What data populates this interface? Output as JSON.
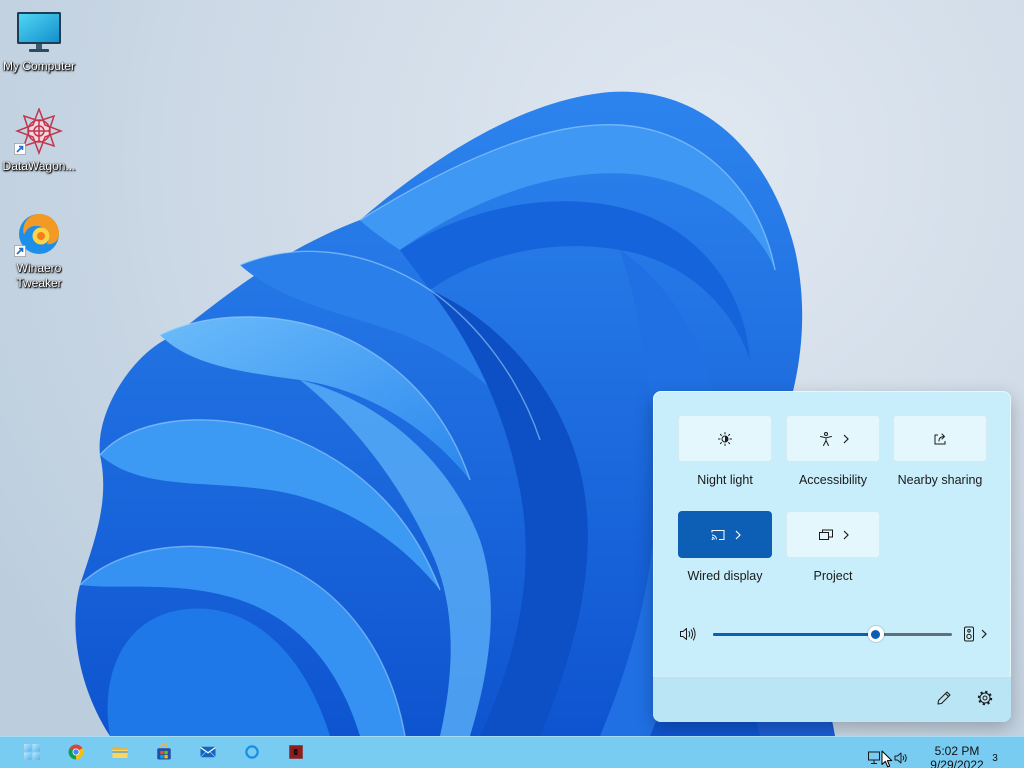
{
  "desktop": {
    "icons": [
      {
        "label": "My Computer",
        "icon": "my-computer-icon",
        "shortcut": false
      },
      {
        "label": "DataWagon...",
        "icon": "datawagon-icon",
        "shortcut": true
      },
      {
        "label": "Winaero Tweaker",
        "icon": "winaero-tweaker-icon",
        "shortcut": true
      }
    ]
  },
  "quick_settings": {
    "tiles": [
      {
        "label": "Night light",
        "icon": "night-light-icon",
        "active": false,
        "chevron": false
      },
      {
        "label": "Accessibility",
        "icon": "accessibility-icon",
        "active": false,
        "chevron": true
      },
      {
        "label": "Nearby sharing",
        "icon": "nearby-sharing-icon",
        "active": false,
        "chevron": false
      },
      {
        "label": "Wired display",
        "icon": "cast-icon",
        "active": true,
        "chevron": true
      },
      {
        "label": "Project",
        "icon": "project-icon",
        "active": false,
        "chevron": true
      }
    ],
    "volume": {
      "level_percent": 68,
      "icon": "speaker-icon",
      "output_icon": "speaker-device-icon"
    },
    "footer": {
      "edit_icon": "pencil-icon",
      "settings_icon": "gear-icon"
    }
  },
  "taskbar": {
    "apps": [
      {
        "icon": "start-icon"
      },
      {
        "icon": "chrome-icon"
      },
      {
        "icon": "file-explorer-icon"
      },
      {
        "icon": "store-icon"
      },
      {
        "icon": "mail-icon"
      },
      {
        "icon": "cortana-icon"
      },
      {
        "icon": "red-app-icon"
      }
    ],
    "tray": {
      "network_icon": "network-icon",
      "volume_icon": "speaker-icon",
      "time": "5:02 PM",
      "date": "9/29/2022",
      "notification_count": "3"
    }
  },
  "colors": {
    "accent": "#0c5fb5",
    "panel": "#c9eefb",
    "taskbar": "#78ccf2"
  }
}
